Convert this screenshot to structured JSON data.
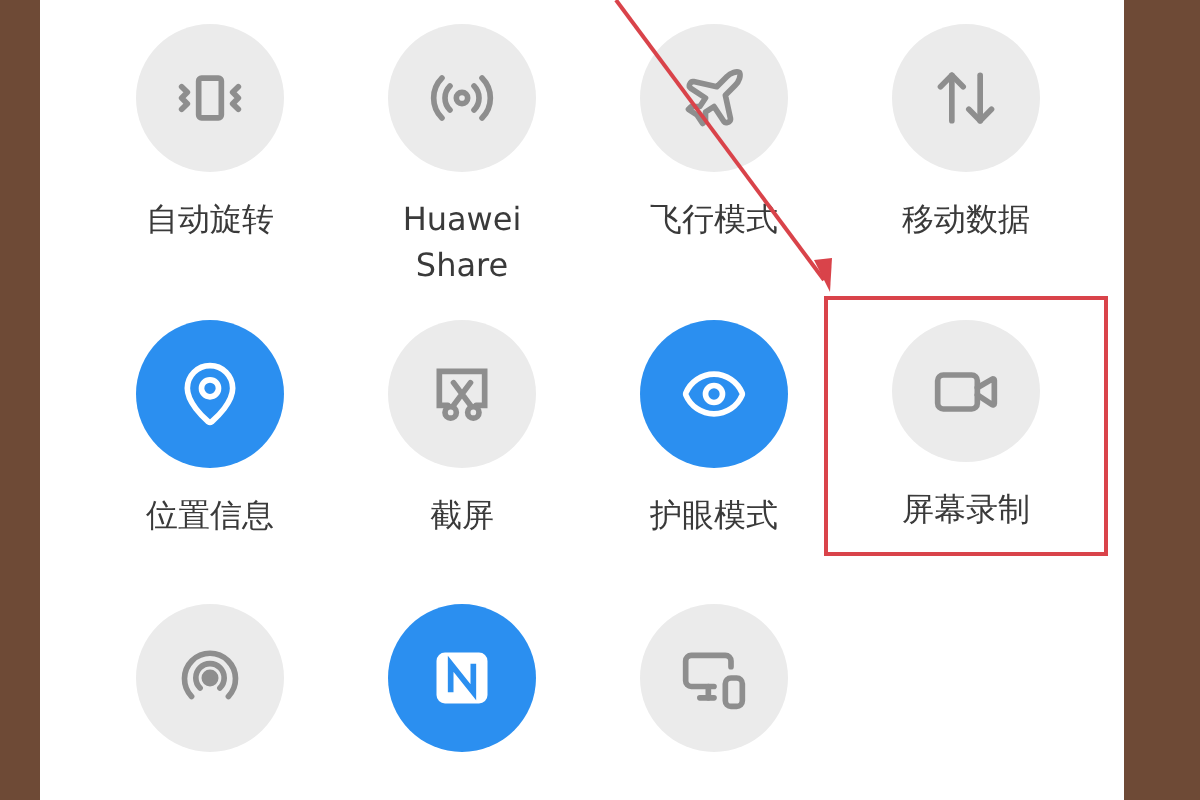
{
  "quick_settings": {
    "rows": [
      [
        {
          "label": "自动旋转",
          "on": false,
          "highlighted": false
        },
        {
          "label": "Huawei Share",
          "on": false,
          "highlighted": false
        },
        {
          "label": "飞行模式",
          "on": false,
          "highlighted": false
        },
        {
          "label": "移动数据",
          "on": false,
          "highlighted": false
        }
      ],
      [
        {
          "label": "位置信息",
          "on": true,
          "highlighted": false
        },
        {
          "label": "截屏",
          "on": false,
          "highlighted": false
        },
        {
          "label": "护眼模式",
          "on": true,
          "highlighted": false
        },
        {
          "label": "屏幕录制",
          "on": false,
          "highlighted": true
        }
      ],
      [
        {
          "on": false,
          "highlighted": false
        },
        {
          "on": true,
          "highlighted": false
        },
        {
          "on": false,
          "highlighted": false
        }
      ]
    ]
  }
}
